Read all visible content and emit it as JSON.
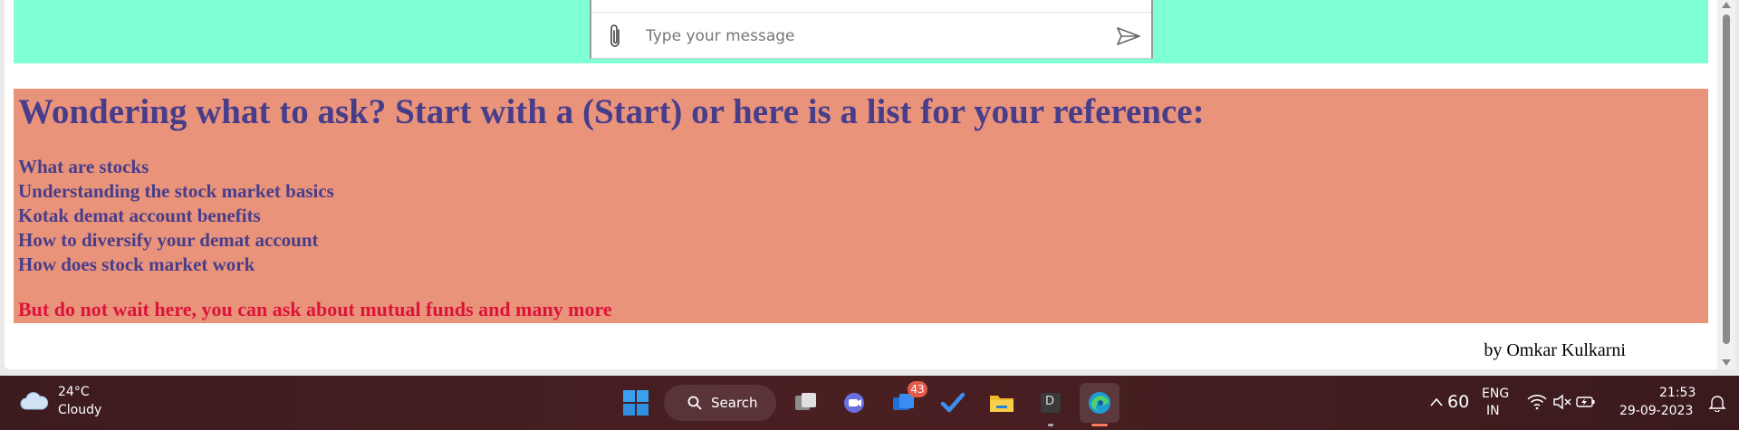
{
  "chat": {
    "input_placeholder": "Type your message",
    "attach_icon": "paperclip-icon",
    "send_icon": "send-icon"
  },
  "reference": {
    "heading": "Wondering what to ask? Start with a (Start) or here is a list for your reference:",
    "items": [
      "What are stocks",
      "Understanding the stock market basics",
      "Kotak demat account benefits",
      "How to diversify your demat account",
      "How does stock market work"
    ],
    "note": "But do not wait here, you can ask about mutual funds and many more"
  },
  "byline": "by Omkar Kulkarni",
  "colors": {
    "chat_band": "#7fffd4",
    "reference_panel": "#e9937a",
    "heading_text": "#483d8b",
    "note_text": "#dc143c"
  },
  "taskbar": {
    "weather": {
      "temperature": "24°C",
      "condition": "Cloudy"
    },
    "search_label": "Search",
    "mail_badge": "43",
    "dev_app_letter": "D",
    "tray": {
      "battery_percent": "60",
      "language": "ENG",
      "region": "IN",
      "time": "21:53",
      "date": "29-09-2023"
    }
  }
}
